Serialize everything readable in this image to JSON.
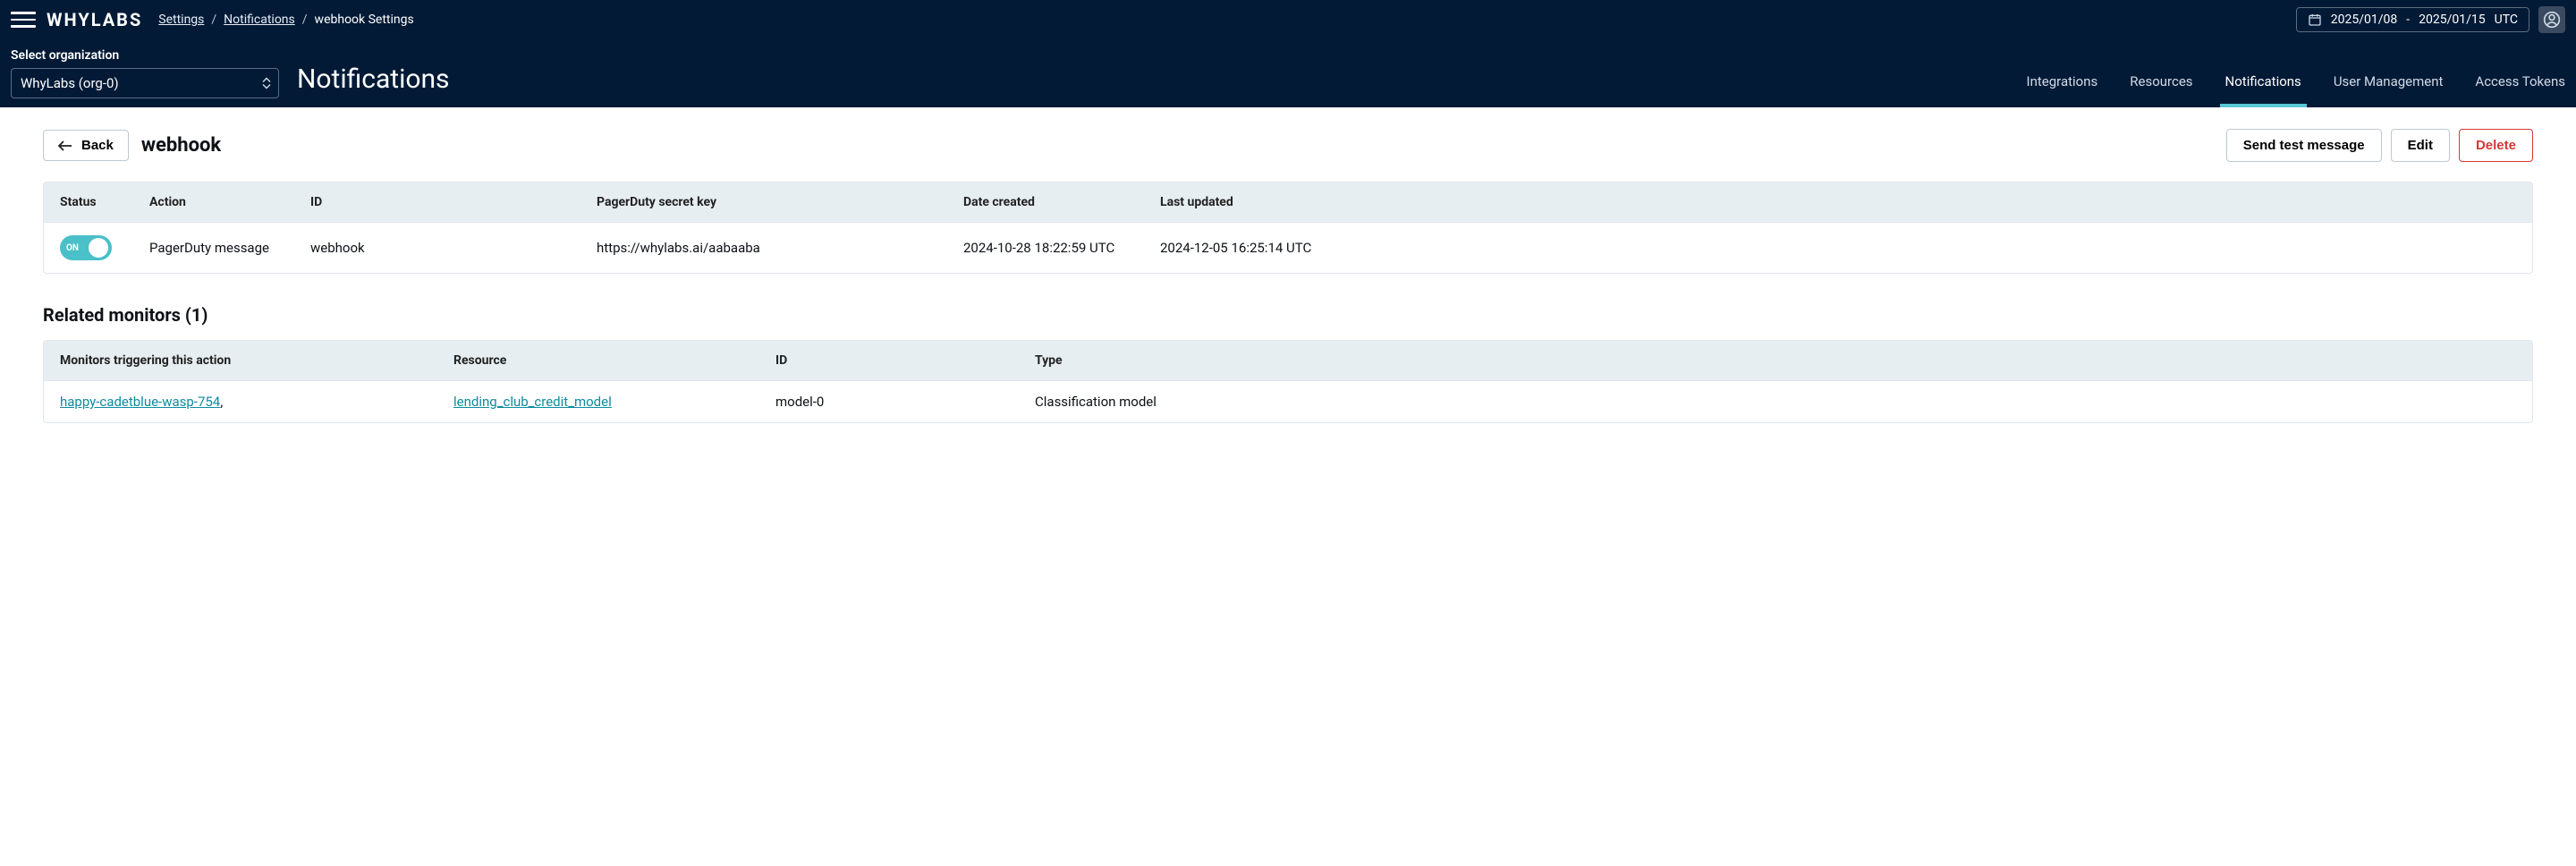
{
  "logo": "WHYLABS",
  "breadcrumb": {
    "a": "Settings",
    "b": "Notifications",
    "c": "webhook Settings"
  },
  "date_range": {
    "from": "2025/01/08",
    "to": "2025/01/15",
    "tz": "UTC",
    "dash": "-"
  },
  "org": {
    "label": "Select organization",
    "value": "WhyLabs (org-0)"
  },
  "page_title": "Notifications",
  "tabs": {
    "integrations": "Integrations",
    "resources": "Resources",
    "notifications": "Notifications",
    "user_mgmt": "User Management",
    "access_tokens": "Access Tokens"
  },
  "back": "Back",
  "detail_title": "webhook",
  "buttons": {
    "send_test": "Send test message",
    "edit": "Edit",
    "delete": "Delete"
  },
  "main_table": {
    "headers": {
      "status": "Status",
      "action": "Action",
      "id": "ID",
      "secret": "PagerDuty secret key",
      "created": "Date created",
      "updated": "Last updated"
    },
    "row": {
      "toggle_label": "ON",
      "action": "PagerDuty message",
      "id": "webhook",
      "secret": "https://whylabs.ai/aabaaba",
      "created": "2024-10-28 18:22:59 UTC",
      "updated": "2024-12-05 16:25:14 UTC"
    }
  },
  "monitors": {
    "title": "Related monitors (1)",
    "headers": {
      "monitor": "Monitors triggering this action",
      "resource": "Resource",
      "id": "ID",
      "type": "Type"
    },
    "row": {
      "monitor": "happy-cadetblue-wasp-754",
      "comma": ",",
      "resource": "lending_club_credit_model",
      "id": "model-0",
      "type": "Classification model"
    }
  }
}
